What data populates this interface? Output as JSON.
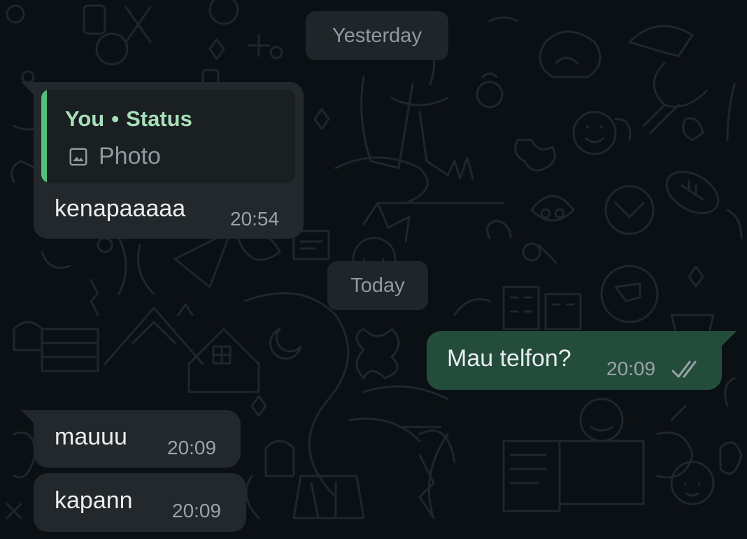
{
  "date_separators": {
    "yesterday": "Yesterday",
    "today": "Today"
  },
  "messages": [
    {
      "direction": "incoming",
      "reply": {
        "author": "You",
        "separator": "•",
        "context": "Status",
        "media_icon": "image-icon",
        "media_label": "Photo"
      },
      "text": "kenapaaaaa",
      "time": "20:54"
    },
    {
      "direction": "outgoing",
      "text": "Mau telfon?",
      "time": "20:09",
      "status_icon": "double-check-icon"
    },
    {
      "direction": "incoming",
      "text": "mauuu",
      "time": "20:09"
    },
    {
      "direction": "incoming",
      "text": "kapann",
      "time": "20:09"
    }
  ],
  "colors": {
    "background": "#0b1014",
    "incoming_bubble": "#22282c",
    "outgoing_bubble": "#234c3b",
    "quote_accent": "#53c07b",
    "quote_author": "#a7dfb9"
  }
}
